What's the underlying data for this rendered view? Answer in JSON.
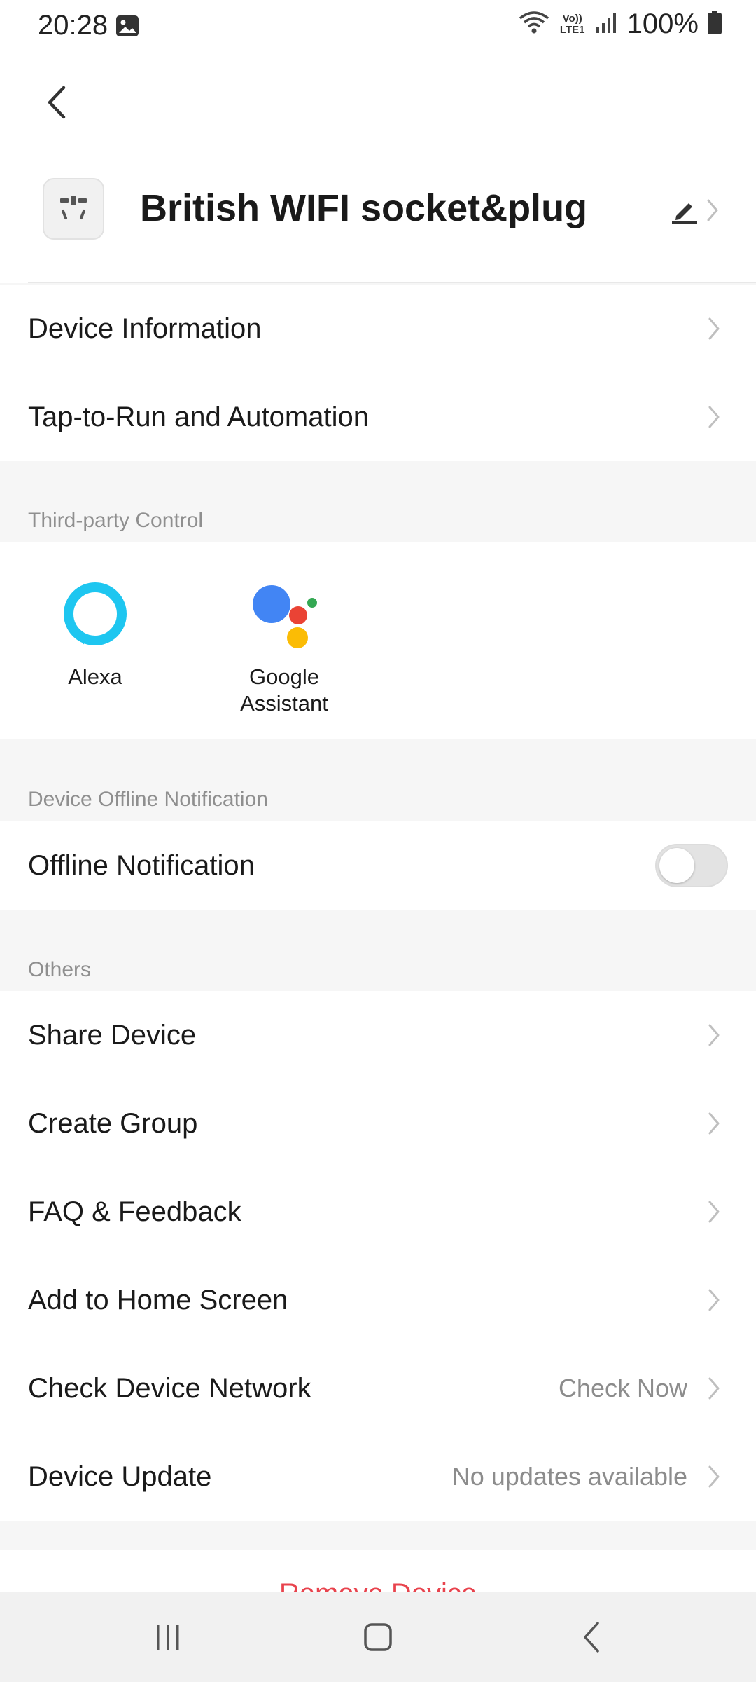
{
  "status_bar": {
    "time": "20:28",
    "network_label": "Vo)) LTE1",
    "battery": "100%"
  },
  "header": {
    "device_name": "British WIFI socket&plug"
  },
  "menu_top": [
    {
      "label": "Device Information"
    },
    {
      "label": "Tap-to-Run and Automation"
    }
  ],
  "third_party": {
    "title": "Third-party Control",
    "items": [
      {
        "label": "Alexa",
        "icon": "alexa-icon"
      },
      {
        "label": "Google Assistant",
        "icon": "google-assistant-icon"
      }
    ]
  },
  "offline": {
    "title": "Device Offline Notification",
    "label": "Offline Notification",
    "enabled": false
  },
  "others": {
    "title": "Others",
    "items": [
      {
        "label": "Share Device",
        "value": ""
      },
      {
        "label": "Create Group",
        "value": ""
      },
      {
        "label": "FAQ & Feedback",
        "value": ""
      },
      {
        "label": "Add to Home Screen",
        "value": ""
      },
      {
        "label": "Check Device Network",
        "value": "Check Now"
      },
      {
        "label": "Device Update",
        "value": "No updates available"
      }
    ]
  },
  "remove": {
    "label": "Remove Device",
    "color": "#e8434d"
  },
  "colors": {
    "alexa": "#1ec6f0",
    "google_blue": "#4285f4",
    "google_red": "#ea4335",
    "google_yellow": "#fbbc05",
    "google_green": "#34a853"
  }
}
